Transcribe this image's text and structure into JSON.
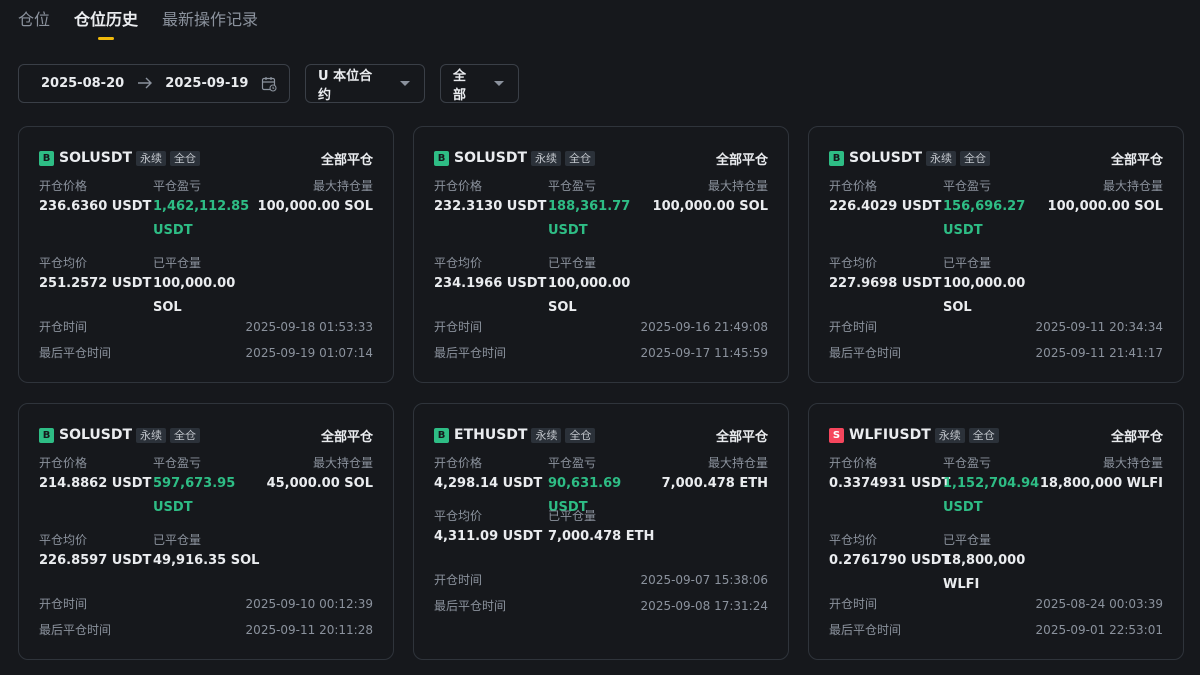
{
  "tabs": [
    {
      "label": "仓位",
      "active": false
    },
    {
      "label": "仓位历史",
      "active": true
    },
    {
      "label": "最新操作记录",
      "active": false
    }
  ],
  "filters": {
    "date_from": "2025-08-20",
    "date_to": "2025-09-19",
    "contract_type": "U 本位合约",
    "direction": "全部"
  },
  "labels": {
    "open_price": "开仓价格",
    "pnl": "平仓盈亏",
    "max_position": "最大持仓量",
    "avg_close": "平仓均价",
    "closed_qty": "已平仓量",
    "open_time": "开仓时间",
    "last_close_time": "最后平仓时间",
    "perpetual": "永续",
    "cross": "全仓",
    "status": "全部平仓"
  },
  "cards": [
    {
      "side": "B",
      "symbol": "SOLUSDT",
      "open_price": "236.6360 USDT",
      "pnl_line1": "1,462,112.85",
      "pnl_line2": "USDT",
      "max_position": "100,000.00 SOL",
      "avg_close": "251.2572 USDT",
      "closed_qty": "100,000.00 SOL",
      "open_time": "2025-09-18 01:53:33",
      "last_close_time": "2025-09-19 01:07:14"
    },
    {
      "side": "B",
      "symbol": "SOLUSDT",
      "open_price": "232.3130 USDT",
      "pnl_line1": "188,361.77",
      "pnl_line2": "USDT",
      "max_position": "100,000.00 SOL",
      "avg_close": "234.1966 USDT",
      "closed_qty": "100,000.00 SOL",
      "open_time": "2025-09-16 21:49:08",
      "last_close_time": "2025-09-17 11:45:59"
    },
    {
      "side": "B",
      "symbol": "SOLUSDT",
      "open_price": "226.4029 USDT",
      "pnl_line1": "156,696.27",
      "pnl_line2": "USDT",
      "max_position": "100,000.00 SOL",
      "avg_close": "227.9698 USDT",
      "closed_qty": "100,000.00 SOL",
      "open_time": "2025-09-11 20:34:34",
      "last_close_time": "2025-09-11 21:41:17"
    },
    {
      "side": "B",
      "symbol": "SOLUSDT",
      "open_price": "214.8862 USDT",
      "pnl_line1": "597,673.95",
      "pnl_line2": "USDT",
      "max_position": "45,000.00 SOL",
      "avg_close": "226.8597 USDT",
      "closed_qty": "49,916.35 SOL",
      "open_time": "2025-09-10 00:12:39",
      "last_close_time": "2025-09-11 20:11:28"
    },
    {
      "side": "B",
      "symbol": "ETHUSDT",
      "open_price": "4,298.14 USDT",
      "pnl_line1": "90,631.69 USDT",
      "pnl_line2": "",
      "max_position": "7,000.478 ETH",
      "avg_close": "4,311.09 USDT",
      "closed_qty": "7,000.478 ETH",
      "open_time": "2025-09-07 15:38:06",
      "last_close_time": "2025-09-08 17:31:24"
    },
    {
      "side": "S",
      "symbol": "WLFIUSDT",
      "open_price": "0.3374931 USDT",
      "pnl_line1": "1,152,704.94",
      "pnl_line2": "USDT",
      "max_position": "18,800,000 WLFI",
      "avg_close": "0.2761790 USDT",
      "closed_qty": "18,800,000 WLFI",
      "open_time": "2025-08-24 00:03:39",
      "last_close_time": "2025-09-01 22:53:01"
    }
  ],
  "colors": {
    "background": "#16181c",
    "profit_green": "#2ebd85",
    "buy_badge": "#2ebd85",
    "sell_badge": "#f6465d",
    "tab_indicator": "#f0b90b"
  },
  "icons": {
    "date_arrow": "arrow-right-icon",
    "calendar": "calendar-icon",
    "dropdown": "caret-down-icon"
  }
}
